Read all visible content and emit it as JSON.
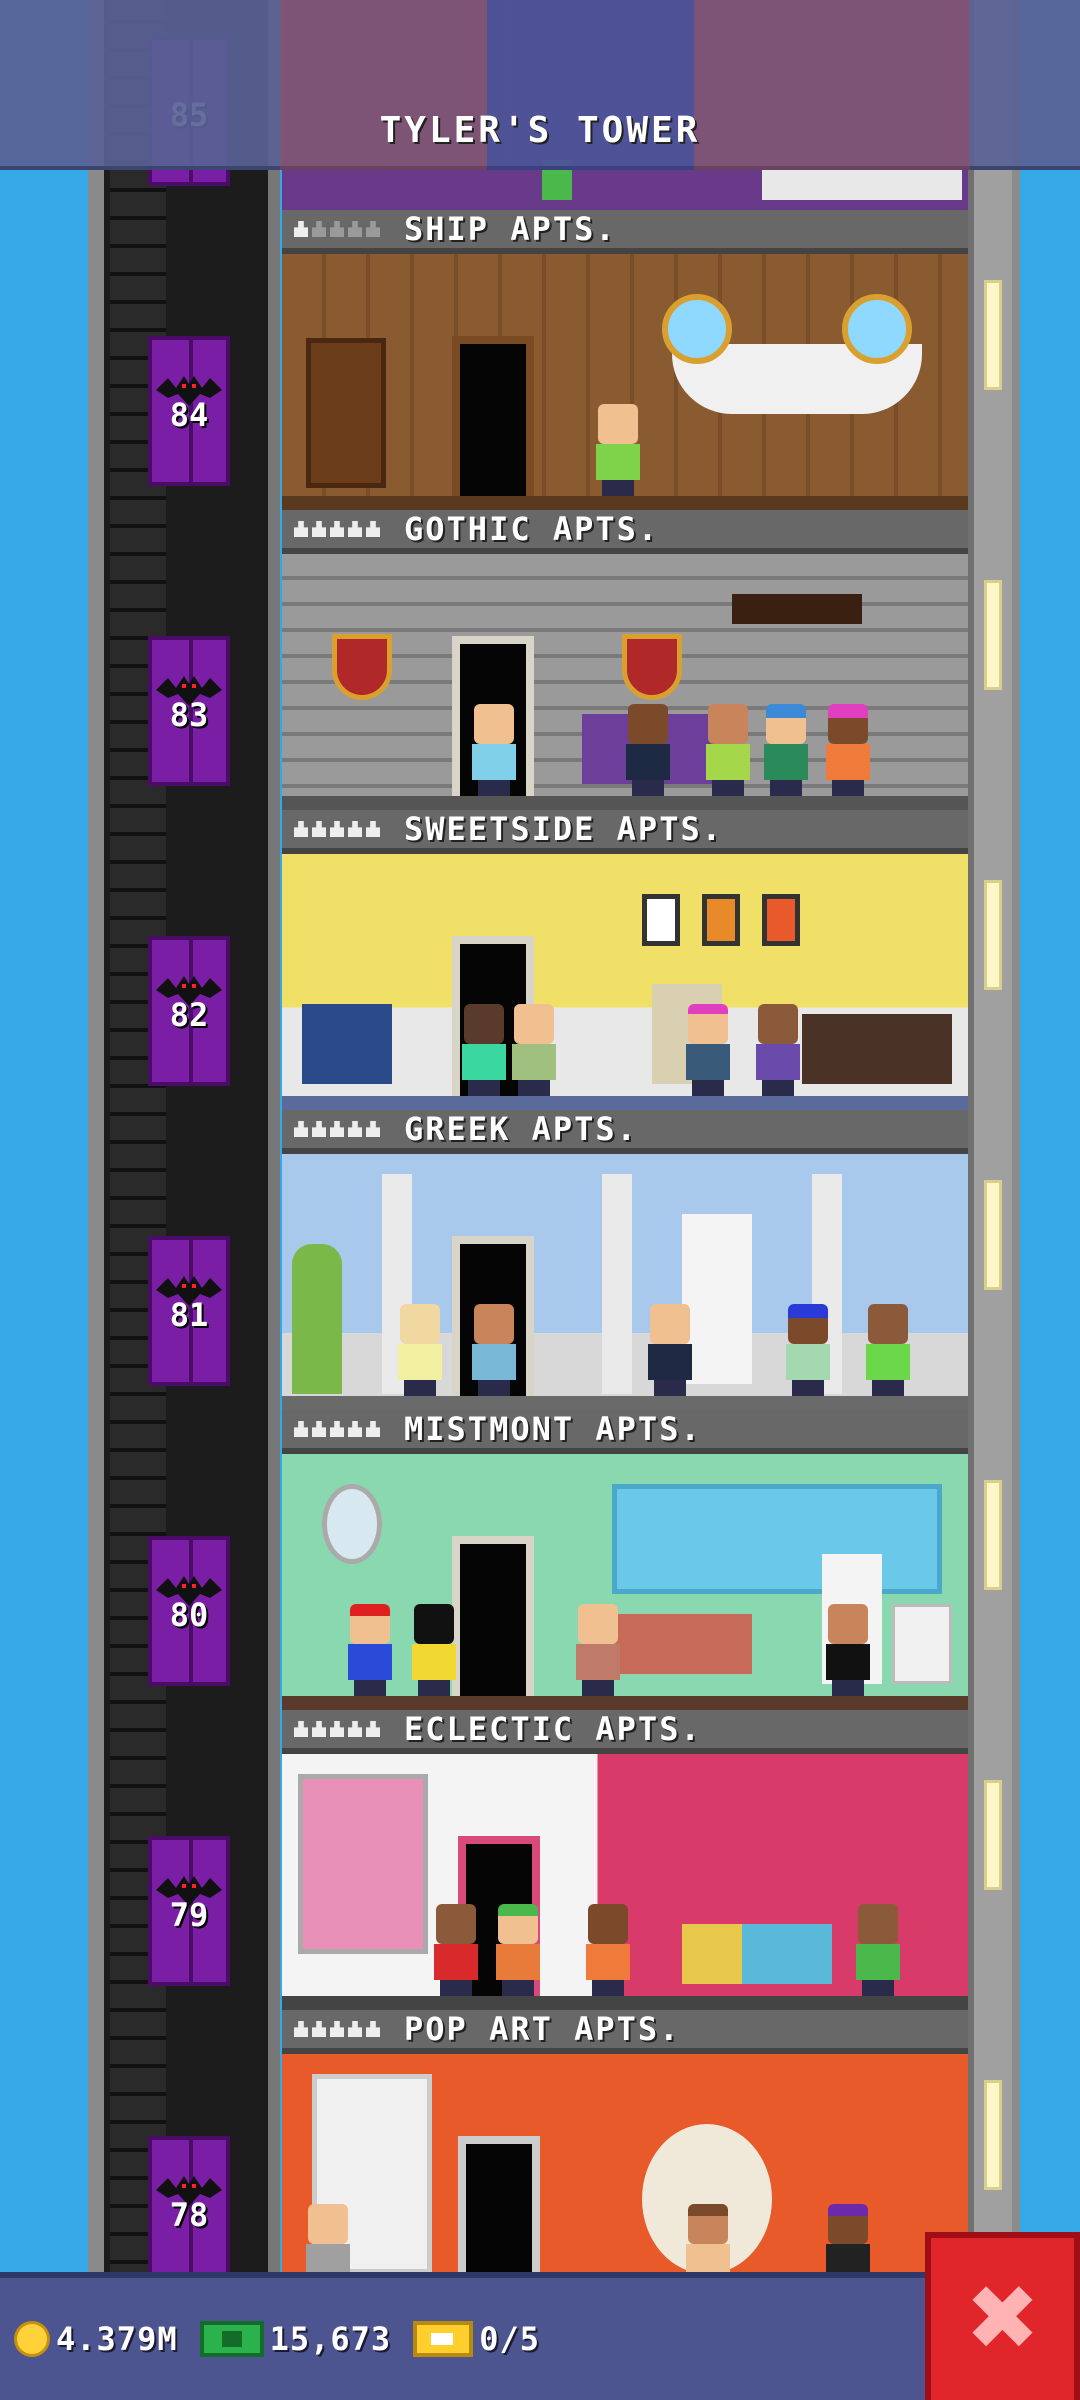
{
  "header": {
    "tower_name": "TYLER'S TOWER",
    "partial_floor_number": "85"
  },
  "floors": [
    {
      "number": "84",
      "name": "SHIP APTS.",
      "residents": 1,
      "capacity": 5,
      "theme": "ship"
    },
    {
      "number": "83",
      "name": "GOTHIC APTS.",
      "residents": 5,
      "capacity": 5,
      "theme": "gothic"
    },
    {
      "number": "82",
      "name": "SWEETSIDE APTS.",
      "residents": 5,
      "capacity": 5,
      "theme": "sweetside"
    },
    {
      "number": "81",
      "name": "GREEK APTS.",
      "residents": 5,
      "capacity": 5,
      "theme": "greek"
    },
    {
      "number": "80",
      "name": "MISTMONT APTS.",
      "residents": 5,
      "capacity": 5,
      "theme": "mistmont"
    },
    {
      "number": "79",
      "name": "ECLECTIC APTS.",
      "residents": 5,
      "capacity": 5,
      "theme": "eclectic"
    },
    {
      "number": "78",
      "name": "POP ART APTS.",
      "residents": 5,
      "capacity": 5,
      "theme": "popart"
    }
  ],
  "status_bar": {
    "coins": "4.379M",
    "bux": "15,673",
    "tickets": "0/5"
  },
  "icons": {
    "coin": "coin-icon",
    "bux": "tower-bux-icon",
    "ticket": "golden-ticket-icon",
    "close": "close-icon",
    "resident": "person-icon"
  },
  "colors": {
    "sky": "#35a8e8",
    "elevator": "#7b1ea6",
    "close_button": "#e0262b",
    "bottom_bar": "#4d5590"
  }
}
